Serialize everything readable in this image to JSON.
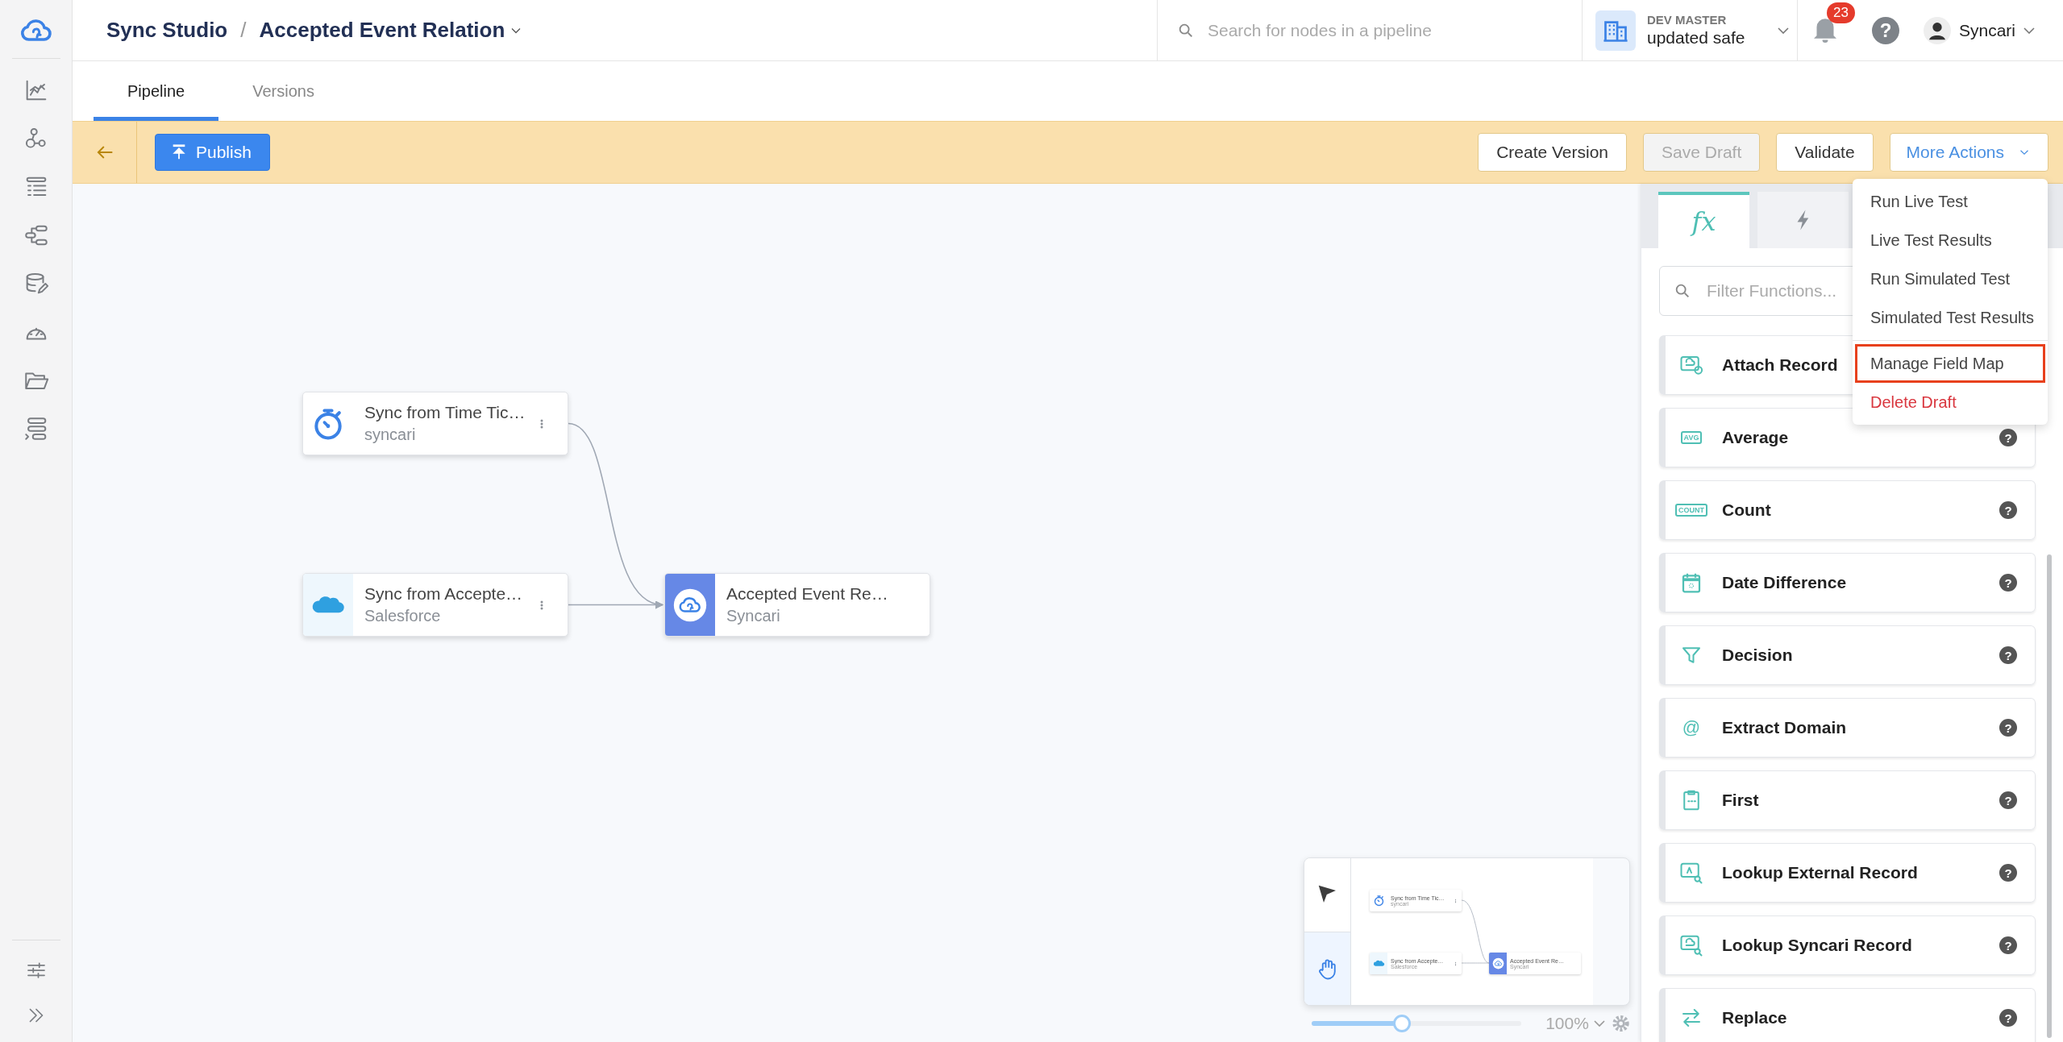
{
  "breadcrumb": {
    "root": "Sync Studio",
    "separator": "/",
    "current": "Accepted Event Relation"
  },
  "search": {
    "placeholder": "Search for nodes in a pipeline"
  },
  "workspace": {
    "label": "DEV MASTER",
    "name": "updated safe"
  },
  "notifications": {
    "count": "23"
  },
  "help": {
    "glyph": "?"
  },
  "user": {
    "name": "Syncari"
  },
  "tabs": [
    {
      "label": "Pipeline",
      "selected": true
    },
    {
      "label": "Versions",
      "selected": false
    }
  ],
  "toolbar": {
    "publish": "Publish",
    "actions": [
      {
        "label": "Create Version",
        "kind": "button",
        "disabled": false
      },
      {
        "label": "Save Draft",
        "kind": "button",
        "disabled": true
      },
      {
        "label": "Validate",
        "kind": "button",
        "disabled": false
      },
      {
        "label": "More Actions",
        "kind": "dropdown",
        "disabled": false
      }
    ]
  },
  "menu": [
    {
      "items": [
        {
          "label": "Run Live Test",
          "kind": "normal",
          "highlighted": false
        },
        {
          "label": "Live Test Results",
          "kind": "normal",
          "highlighted": false
        },
        {
          "label": "Run Simulated Test",
          "kind": "normal",
          "highlighted": false
        },
        {
          "label": "Simulated Test Results",
          "kind": "normal",
          "highlighted": false
        }
      ]
    },
    {
      "items": [
        {
          "label": "Manage Field Map",
          "kind": "normal",
          "highlighted": true
        },
        {
          "label": "Delete Draft",
          "kind": "danger",
          "highlighted": false
        }
      ]
    }
  ],
  "nodes": [
    {
      "title": "Sync from Time Tic…",
      "subtitle": "syncari",
      "kind": "timer"
    },
    {
      "title": "Sync from Accepte…",
      "subtitle": "Salesforce",
      "kind": "salesforce"
    },
    {
      "title": "Accepted Event Re…",
      "subtitle": "Syncari",
      "kind": "syncari"
    }
  ],
  "minimap": {
    "tools": [
      {
        "kind": "pointer",
        "selected": false
      },
      {
        "kind": "hand",
        "selected": true
      }
    ],
    "nodes": [
      {
        "title": "Sync from Time Tic…",
        "subtitle": "syncari",
        "kind": "timer"
      },
      {
        "title": "Sync from Accepte…",
        "subtitle": "Salesforce",
        "kind": "salesforce"
      },
      {
        "title": "Accepted Event Re…",
        "subtitle": "Syncari",
        "kind": "syncari"
      }
    ],
    "zoom": {
      "level": 0.43,
      "reading": "100%"
    }
  },
  "panel": {
    "tabs": [
      {
        "kind": "functions",
        "label": "fx",
        "selected": true
      },
      {
        "kind": "triggers",
        "selected": false
      }
    ],
    "filter": {
      "placeholder": "Filter Functions..."
    },
    "functions": [
      {
        "name": "Attach Record",
        "kind": "attach"
      },
      {
        "name": "Average",
        "kind": "label",
        "icon_text": "AVG",
        "help": "?"
      },
      {
        "name": "Count",
        "kind": "label",
        "icon_text": "COUNT",
        "help": "?"
      },
      {
        "name": "Date Difference",
        "kind": "calendar",
        "help": "?"
      },
      {
        "name": "Decision",
        "kind": "funnel",
        "help": "?"
      },
      {
        "name": "Extract Domain",
        "kind": "glyph",
        "icon_text": "@",
        "help": "?"
      },
      {
        "name": "First",
        "kind": "first",
        "help": "?"
      },
      {
        "name": "Lookup External Record",
        "kind": "lookup",
        "help": "?"
      },
      {
        "name": "Lookup Syncari Record",
        "kind": "lookup-cloud",
        "help": "?"
      },
      {
        "name": "Replace",
        "kind": "arrows",
        "help": "?"
      }
    ]
  }
}
